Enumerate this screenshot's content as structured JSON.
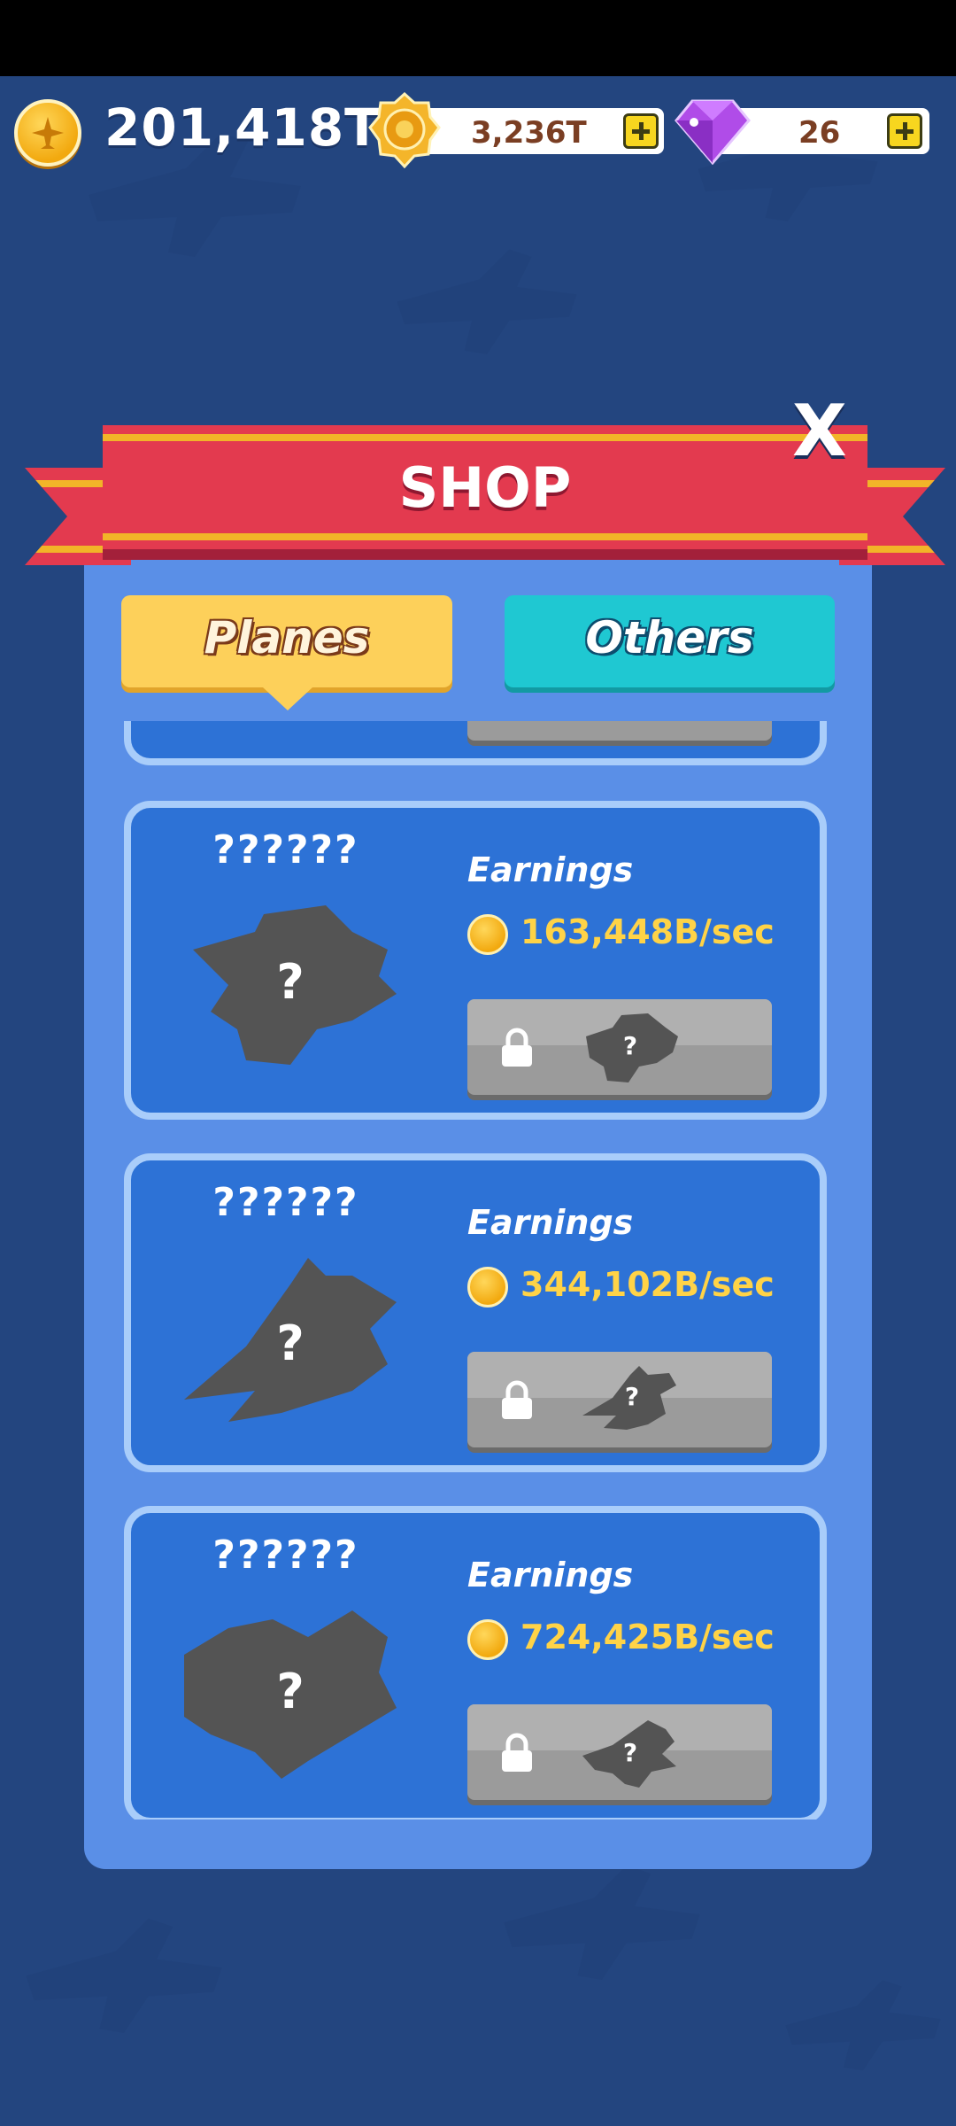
{
  "topbar": {
    "main_balance": "201,418T",
    "medal_balance": "3,236T",
    "gem_balance": "26"
  },
  "shop": {
    "title": "SHOP",
    "close_label": "X",
    "tabs": [
      {
        "label": "Planes",
        "selected": true
      },
      {
        "label": "Others",
        "selected": false
      }
    ],
    "items": [
      {
        "name": "??????",
        "earnings_label": "Earnings",
        "earnings": "163,448B/sec",
        "locked": true
      },
      {
        "name": "??????",
        "earnings_label": "Earnings",
        "earnings": "344,102B/sec",
        "locked": true
      },
      {
        "name": "??????",
        "earnings_label": "Earnings",
        "earnings": "724,425B/sec",
        "locked": true
      }
    ]
  },
  "colors": {
    "background": "#23457f",
    "ribbon": "#e33a4f",
    "tab_planes": "#fdd05a",
    "tab_others": "#1fc8d2",
    "earnings_text": "#ffd347"
  },
  "icons": {
    "coin": "plane-coin-icon",
    "medal": "medal-icon",
    "gem": "gem-icon",
    "plus": "plus-icon",
    "lock": "lock-icon"
  }
}
